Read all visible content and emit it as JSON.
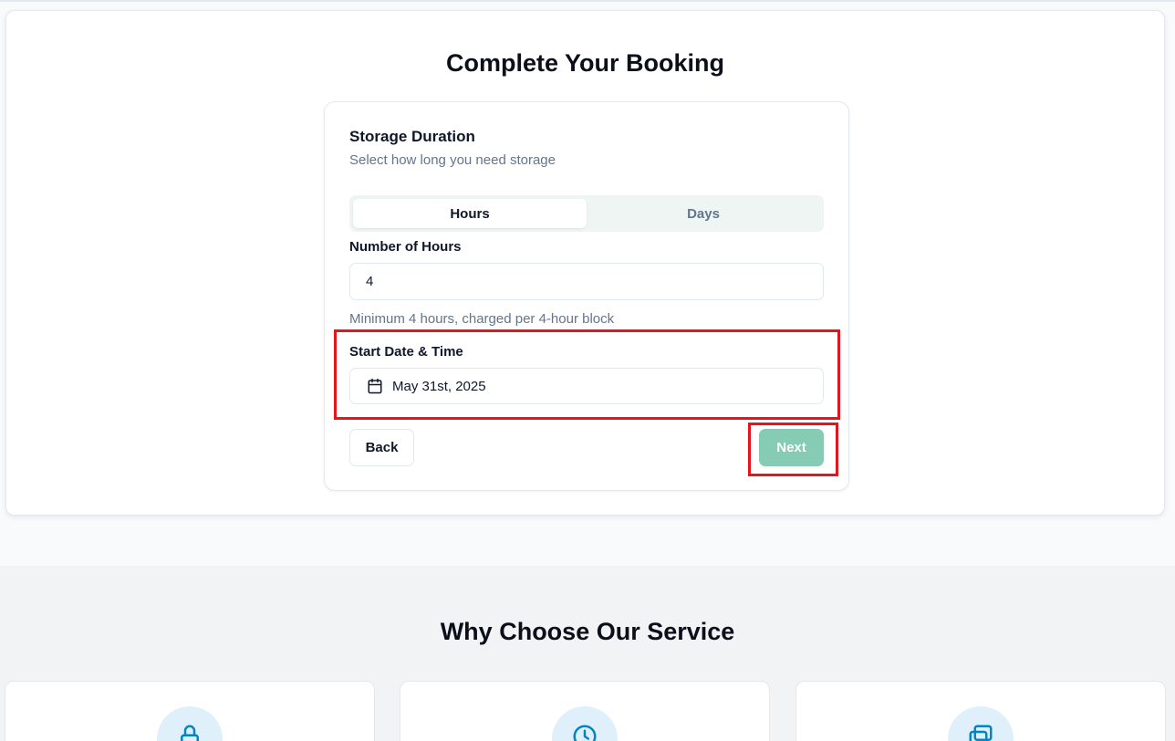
{
  "booking": {
    "title": "Complete Your Booking",
    "section_title": "Storage Duration",
    "section_subtitle": "Select how long you need storage",
    "toggle": {
      "options": [
        "Hours",
        "Days"
      ],
      "selected": "Hours"
    },
    "hours_label": "Number of Hours",
    "hours_value": "4",
    "hours_hint": "Minimum 4 hours, charged per 4-hour block",
    "start_label": "Start Date & Time",
    "start_value": "May 31st, 2025",
    "back_label": "Back",
    "next_label": "Next"
  },
  "why": {
    "title": "Why Choose Our Service",
    "features": [
      {
        "icon": "lock-icon"
      },
      {
        "icon": "clock-icon"
      },
      {
        "icon": "cards-icon"
      }
    ]
  },
  "colors": {
    "accent": "#86cbb3",
    "highlight": "#e8141b",
    "icon_bg": "#dff0fb",
    "icon_stroke": "#0284c7"
  }
}
